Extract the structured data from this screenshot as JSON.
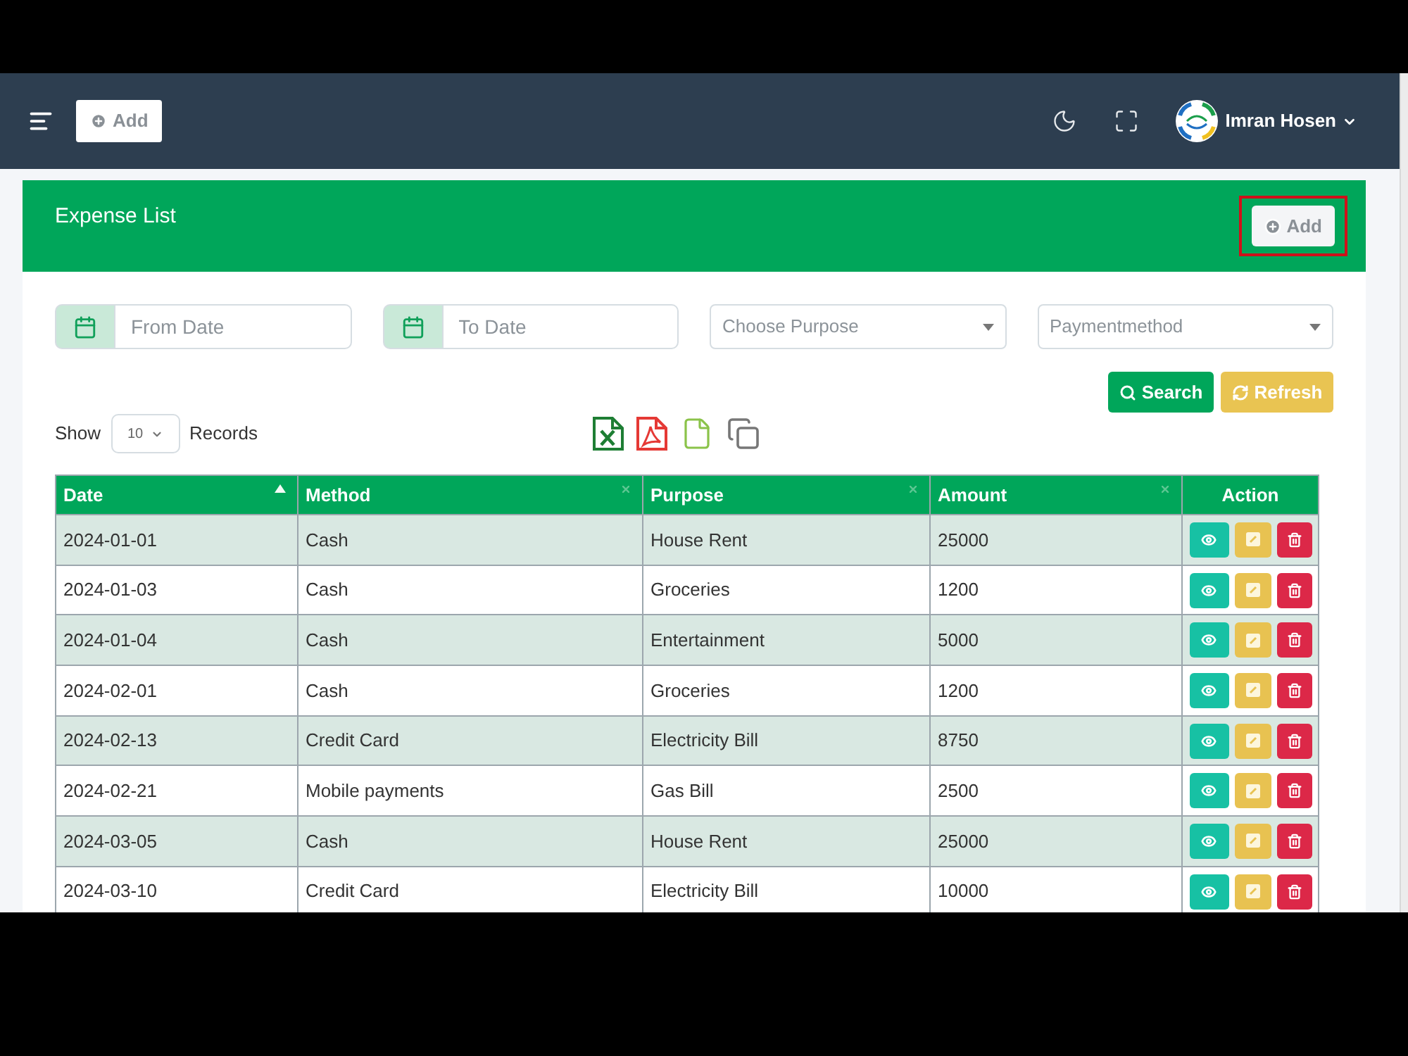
{
  "navbar": {
    "add_button": "Add",
    "user_name": "Imran Hosen"
  },
  "card": {
    "title": "Expense List",
    "add_button": {
      "label": "Add",
      "highlighted": true
    }
  },
  "filters": {
    "from_date": {
      "placeholder": "From Date"
    },
    "to_date": {
      "placeholder": "To Date"
    },
    "purpose": {
      "placeholder": "Choose Purpose"
    },
    "payment_method": {
      "placeholder": "Paymentmethod"
    }
  },
  "buttons": [
    {
      "label": "Search",
      "kind": "search"
    },
    {
      "label": "Refresh",
      "kind": "refresh"
    }
  ],
  "page_size": {
    "prefix": "Show",
    "value": "10",
    "suffix": "Records"
  },
  "table": {
    "columns": [
      {
        "label": "Date",
        "sorted": true
      },
      {
        "label": "Method",
        "sorted": false
      },
      {
        "label": "Purpose",
        "sorted": false
      },
      {
        "label": "Amount",
        "sorted": false
      }
    ],
    "action_column": {
      "label": "Action"
    },
    "rows": [
      {
        "date": "2024-01-01",
        "method": "Cash",
        "purpose": "House Rent",
        "amount": "25000"
      },
      {
        "date": "2024-01-03",
        "method": "Cash",
        "purpose": "Groceries",
        "amount": "1200"
      },
      {
        "date": "2024-01-04",
        "method": "Cash",
        "purpose": "Entertainment",
        "amount": "5000"
      },
      {
        "date": "2024-02-01",
        "method": "Cash",
        "purpose": "Groceries",
        "amount": "1200"
      },
      {
        "date": "2024-02-13",
        "method": "Credit Card",
        "purpose": "Electricity Bill",
        "amount": "8750"
      },
      {
        "date": "2024-02-21",
        "method": "Mobile payments",
        "purpose": "Gas Bill",
        "amount": "2500"
      },
      {
        "date": "2024-03-05",
        "method": "Cash",
        "purpose": "House Rent",
        "amount": "25000"
      },
      {
        "date": "2024-03-10",
        "method": "Credit Card",
        "purpose": "Electricity Bill",
        "amount": "10000"
      }
    ]
  }
}
